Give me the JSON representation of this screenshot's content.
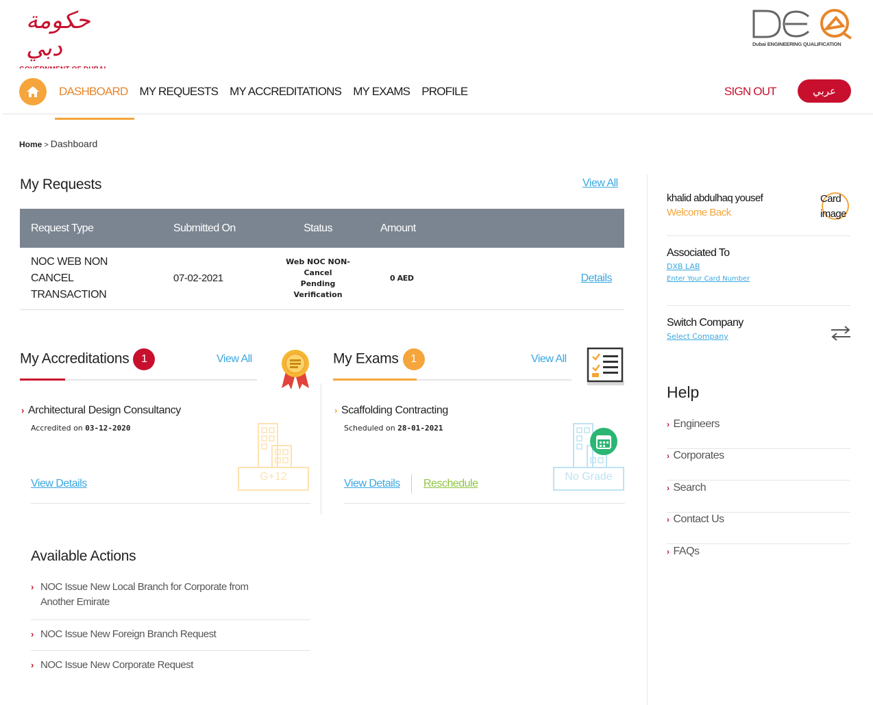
{
  "header": {
    "gov_logo_arabic": "حكومة دبي",
    "gov_logo_text": "GOVERNMENT OF DUBAI",
    "deq_logo_text": "DEQ",
    "deq_logo_subtitle": "Dubai ENGINEERING QUALIFICATION"
  },
  "nav": {
    "items": [
      {
        "label": "DASHBOARD",
        "active": true
      },
      {
        "label": "MY REQUESTS",
        "active": false
      },
      {
        "label": "MY ACCREDITATIONS",
        "active": false
      },
      {
        "label": "MY EXAMS",
        "active": false
      },
      {
        "label": "PROFILE",
        "active": false
      }
    ],
    "sign_out": "SIGN OUT",
    "language": "عربي"
  },
  "breadcrumb": {
    "home": "Home",
    "separator": ">",
    "current": "Dashboard"
  },
  "requests": {
    "title": "My Requests",
    "view_all": "View All",
    "columns": [
      "Request Type",
      "Submitted On",
      "Status",
      "Amount"
    ],
    "rows": [
      {
        "type_line1": "NOC WEB NON CANCEL",
        "type_line2": "TRANSACTION",
        "submitted": "07-02-2021",
        "status_line1": "Web NOC NON-Cancel",
        "status_line2": "Pending Verification",
        "amount": "0 AED",
        "details": "Details"
      }
    ]
  },
  "accreditations": {
    "title": "My Accreditations",
    "count": "1",
    "view_all": "View All",
    "item_title": "Architectural Design Consultancy",
    "item_sub_label": "Accredited on",
    "item_sub_date": "03-12-2020",
    "view_details": "View Details",
    "building_label": "G+12"
  },
  "exams": {
    "title": "My Exams",
    "count": "1",
    "view_all": "View All",
    "item_title": "Scaffolding Contracting",
    "item_sub_label": "Scheduled on",
    "item_sub_date": "28-01-2021",
    "view_details": "View Details",
    "reschedule": "Reschedule",
    "grade_label": "No Grade"
  },
  "actions": {
    "title": "Available Actions",
    "items": [
      {
        "line1": "NOC Issue New Local Branch for Corporate from",
        "line2": "Another Emirate"
      },
      {
        "line1": "NOC Issue New Foreign Branch Request",
        "line2": ""
      },
      {
        "line1": "NOC Issue New Corporate Request",
        "line2": ""
      }
    ]
  },
  "sidebar": {
    "user_name": "khalid abdulhaq yousef",
    "welcome": "Welcome Back",
    "card_image_alt": "Card image",
    "associated_label": "Associated To",
    "associated_company": "DXB LAB",
    "enter_card": "Enter Your Card Number",
    "switch_label": "Switch Company",
    "select_company": "Select Company",
    "help_title": "Help",
    "help_items": [
      "Engineers",
      "Corporates",
      "Search",
      "Contact Us",
      "FAQs"
    ]
  },
  "colors": {
    "brand_red": "#c8102e",
    "accent_orange": "#f5a53b",
    "link_blue": "#3aa7e0",
    "table_header": "#7b8591",
    "reschedule_green": "#8cc63f"
  }
}
